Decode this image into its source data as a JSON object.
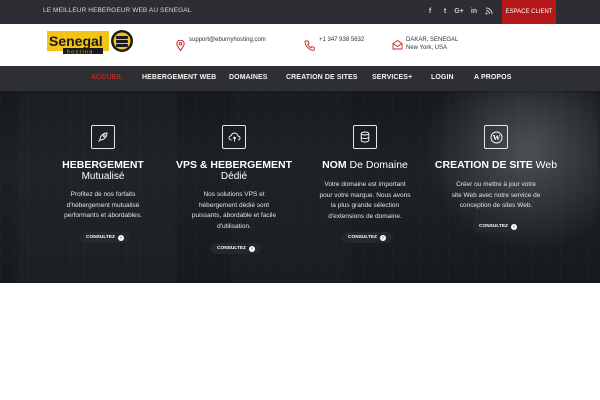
{
  "topbar": {
    "tagline": "LE MEILLEUR HEBERGEUR WEB AU SENEGAL",
    "social": [
      {
        "icon": "facebook-icon",
        "glyph": "f"
      },
      {
        "icon": "twitter-icon",
        "glyph": "t"
      },
      {
        "icon": "google-plus-icon",
        "glyph": "G+"
      },
      {
        "icon": "linkedin-icon",
        "glyph": "in"
      },
      {
        "icon": "rss-icon",
        "glyph": "rss"
      }
    ],
    "client_button": "ESPACE CLIENT"
  },
  "header": {
    "logo_text": "Senegal",
    "logo_sub": "hosting",
    "email": "support@eburnyhosting.com",
    "phone": "+1 347 938 5632",
    "address_line1": "DAKAR, SENEGAL",
    "address_line2": "New York, USA"
  },
  "nav": {
    "items": [
      {
        "label": "ACCUEIL",
        "active": true
      },
      {
        "label": "HEBERGEMENT WEB"
      },
      {
        "label": "DOMAINES"
      },
      {
        "label": "CREATION DE SITES"
      },
      {
        "label": "SERVICES+"
      },
      {
        "label": "LOGIN"
      },
      {
        "label": "A PROPOS"
      }
    ]
  },
  "services": [
    {
      "icon": "rocket-icon",
      "title_bold": "HEBERGEMENT",
      "title_thin": "",
      "subtitle": "Mutualisé",
      "desc": [
        "Profitez de nos forfaits",
        "d'hébergement mutualisé",
        "performants et abordables."
      ],
      "button": "CONSULTEZ"
    },
    {
      "icon": "cloud-upload-icon",
      "title_bold": "VPS & HEBERGEMENT",
      "title_thin": "",
      "subtitle": "Dédié",
      "desc": [
        "Nos solutions VPS et",
        "hébergement dédié sont",
        "puissants, abordable et facile",
        "d'utilisation."
      ],
      "button": "CONSULTEZ"
    },
    {
      "icon": "database-icon",
      "title_bold": "NOM",
      "title_thin": "De Domaine",
      "subtitle": "",
      "desc": [
        "Votre domaine est important",
        "pour votre marque. Nous avons",
        "la plus grande sélection",
        "d'extensions de domaine."
      ],
      "button": "CONSULTEZ"
    },
    {
      "icon": "wordpress-icon",
      "title_bold": "CREATION DE SITE",
      "title_thin": "Web",
      "subtitle": "",
      "desc": [
        "Créer ou mettre à jour votre",
        "site Web avec notre service de",
        "conception de sites Web."
      ],
      "button": "CONSULTEZ"
    }
  ],
  "colors": {
    "topbar_bg": "#2c2e33",
    "accent_red": "#b5181b",
    "nav_bg": "#2e2f32",
    "active_nav": "#c9221f",
    "logo_yellow": "#f2c418"
  }
}
